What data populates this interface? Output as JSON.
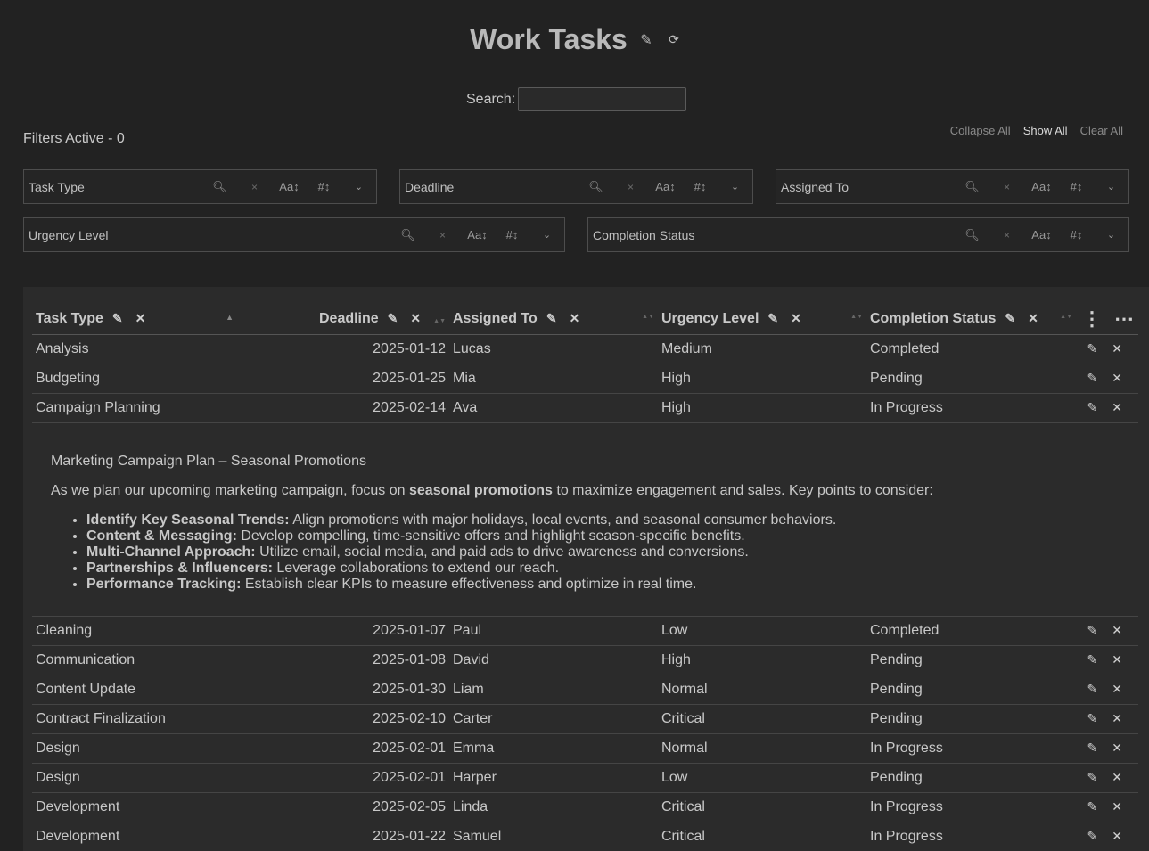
{
  "header": {
    "title": "Work Tasks",
    "edit_icon": "pencil-icon",
    "refresh_icon": "refresh-icon",
    "edit_glyph": "✎",
    "refresh_glyph": "⟳"
  },
  "search": {
    "label": "Search:",
    "value": ""
  },
  "filters": {
    "active_text": "Filters Active - 0",
    "actions": {
      "collapse_all": "Collapse All",
      "show_all": "Show All",
      "clear_all": "Clear All"
    },
    "glyphs": {
      "search": "🔍︎",
      "clear": "×",
      "text_sort": "Aa↕",
      "num_sort": "#↕",
      "chevron": "⌄"
    },
    "fields": [
      {
        "label": "Task Type"
      },
      {
        "label": "Deadline"
      },
      {
        "label": "Assigned To"
      },
      {
        "label": "Urgency Level"
      },
      {
        "label": "Completion Status"
      }
    ]
  },
  "table": {
    "columns": [
      "Task Type",
      "Deadline",
      "Assigned To",
      "Urgency Level",
      "Completion Status"
    ],
    "header_glyphs": {
      "edit": "✎",
      "remove": "✕",
      "sort_active": "▲",
      "sort_both": "▲▼",
      "kebab": "⋮",
      "more": "⋯"
    },
    "row_glyphs": {
      "edit": "✎",
      "delete": "✕"
    },
    "rows_top": [
      [
        "Analysis",
        "2025-01-12",
        "Lucas",
        "Medium",
        "Completed"
      ],
      [
        "Budgeting",
        "2025-01-25",
        "Mia",
        "High",
        "Pending"
      ],
      [
        "Campaign Planning",
        "2025-02-14",
        "Ava",
        "High",
        "In Progress"
      ]
    ],
    "expanded": {
      "heading": "Marketing Campaign Plan – Seasonal Promotions",
      "intro_pre": "As we plan our upcoming marketing campaign, focus on ",
      "intro_bold": "seasonal promotions",
      "intro_post": " to maximize engagement and sales. Key points to consider:",
      "bullets": [
        {
          "bold": "Identify Key Seasonal Trends:",
          "text": " Align promotions with major holidays, local events, and seasonal consumer behaviors."
        },
        {
          "bold": "Content & Messaging:",
          "text": " Develop compelling, time-sensitive offers and highlight season-specific benefits."
        },
        {
          "bold": "Multi-Channel Approach:",
          "text": " Utilize email, social media, and paid ads to drive awareness and conversions."
        },
        {
          "bold": "Partnerships & Influencers:",
          "text": " Leverage collaborations to extend our reach."
        },
        {
          "bold": "Performance Tracking:",
          "text": " Establish clear KPIs to measure effectiveness and optimize in real time."
        }
      ]
    },
    "rows_bottom": [
      [
        "Cleaning",
        "2025-01-07",
        "Paul",
        "Low",
        "Completed"
      ],
      [
        "Communication",
        "2025-01-08",
        "David",
        "High",
        "Pending"
      ],
      [
        "Content Update",
        "2025-01-30",
        "Liam",
        "Normal",
        "Pending"
      ],
      [
        "Contract Finalization",
        "2025-02-10",
        "Carter",
        "Critical",
        "Pending"
      ],
      [
        "Design",
        "2025-02-01",
        "Emma",
        "Normal",
        "In Progress"
      ],
      [
        "Design",
        "2025-02-01",
        "Harper",
        "Low",
        "Pending"
      ],
      [
        "Development",
        "2025-02-05",
        "Linda",
        "Critical",
        "In Progress"
      ],
      [
        "Development",
        "2025-01-22",
        "Samuel",
        "Critical",
        "In Progress"
      ]
    ]
  },
  "colors": {
    "background": "#222222",
    "table_background": "#2b2b2b",
    "text": "#c8c8c8"
  }
}
